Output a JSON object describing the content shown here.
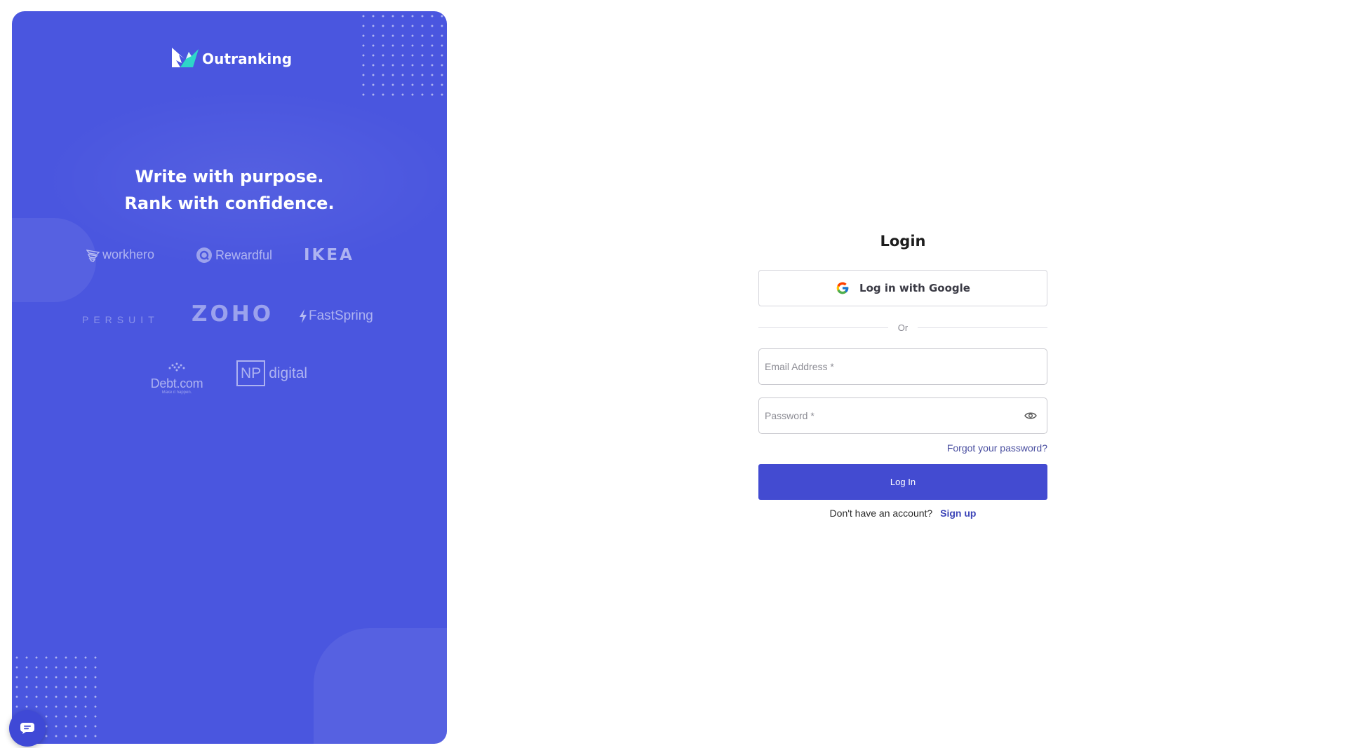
{
  "brand": {
    "name": "Outranking",
    "tagline_line1": "Write with purpose.",
    "tagline_line2": "Rank with confidence.",
    "panel_color": "#4a56df",
    "client_logos": [
      {
        "name": "workhero",
        "icon": "workhero-wing-icon"
      },
      {
        "name": "Rewardful",
        "icon": "rewardful-badge-icon"
      },
      {
        "name": "IKEA"
      },
      {
        "name": "PERSUIT"
      },
      {
        "name": "ZOHO"
      },
      {
        "name": "FastSpring",
        "icon": "lightning-bolt-icon"
      },
      {
        "name": "Debt.com",
        "tagline": "Make it happen."
      },
      {
        "name": "NP digital",
        "box_text": "NP",
        "text": "digital"
      }
    ]
  },
  "chat_widget": {
    "icon": "chat-bubble-icon"
  },
  "login": {
    "title": "Login",
    "google_label": "Log in with Google",
    "google_icon": "google-g-icon",
    "divider_label": "Or",
    "email_placeholder": "Email Address *",
    "password_placeholder": "Password *",
    "password_toggle_icon": "eye-icon",
    "forgot_label": "Forgot your password?",
    "submit_label": "Log In",
    "signup_prompt": "Don't have an account?",
    "signup_label": "Sign up",
    "accent_color": "#434bd1"
  }
}
